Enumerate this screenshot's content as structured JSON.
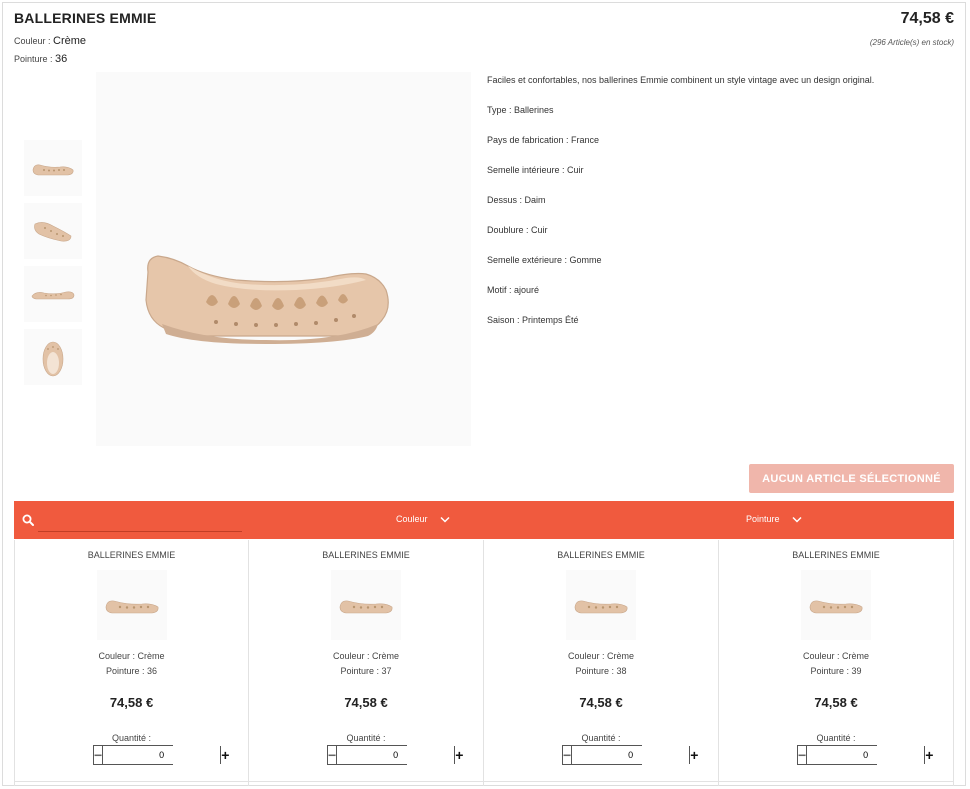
{
  "product": {
    "title": "BALLERINES EMMIE",
    "price": "74,58 €",
    "stock": "(296 Article(s) en stock)",
    "couleur_label": "Couleur : ",
    "couleur_value": "Crème",
    "pointure_label": "Pointure : ",
    "pointure_value": "36"
  },
  "description": [
    "Faciles et confortables, nos ballerines Emmie combinent un style vintage avec un design original.",
    "Type : Ballerines",
    "Pays de fabrication :  France",
    "Semelle intérieure : Cuir",
    "Dessus : Daim",
    "Doublure : Cuir",
    "Semelle extérieure : Gomme",
    "Motif : ajouré",
    "Saison : Printemps Été"
  ],
  "cta_label": "AUCUN ARTICLE SÉLECTIONNÉ",
  "filters": {
    "search_value": "",
    "couleur": "Couleur",
    "pointure": "Pointure"
  },
  "cards": [
    {
      "name": "BALLERINES EMMIE",
      "couleur": "Couleur : Crème",
      "pointure": "Pointure : 36",
      "price": "74,58 €",
      "qty_label": "Quantité :",
      "qty": "0"
    },
    {
      "name": "BALLERINES EMMIE",
      "couleur": "Couleur : Crème",
      "pointure": "Pointure : 37",
      "price": "74,58 €",
      "qty_label": "Quantité :",
      "qty": "0"
    },
    {
      "name": "BALLERINES EMMIE",
      "couleur": "Couleur : Crème",
      "pointure": "Pointure : 38",
      "price": "74,58 €",
      "qty_label": "Quantité :",
      "qty": "0"
    },
    {
      "name": "BALLERINES EMMIE",
      "couleur": "Couleur : Crème",
      "pointure": "Pointure : 39",
      "price": "74,58 €",
      "qty_label": "Quantité :",
      "qty": "0"
    }
  ],
  "colors": {
    "accent": "#f05a3e",
    "cta_disabled": "#f0b6ab",
    "shoe": "#e2c2a6"
  },
  "icons": {
    "search": "search-icon",
    "chevron": "chevron-down-icon",
    "minus": "minus-icon",
    "plus": "plus-icon"
  }
}
